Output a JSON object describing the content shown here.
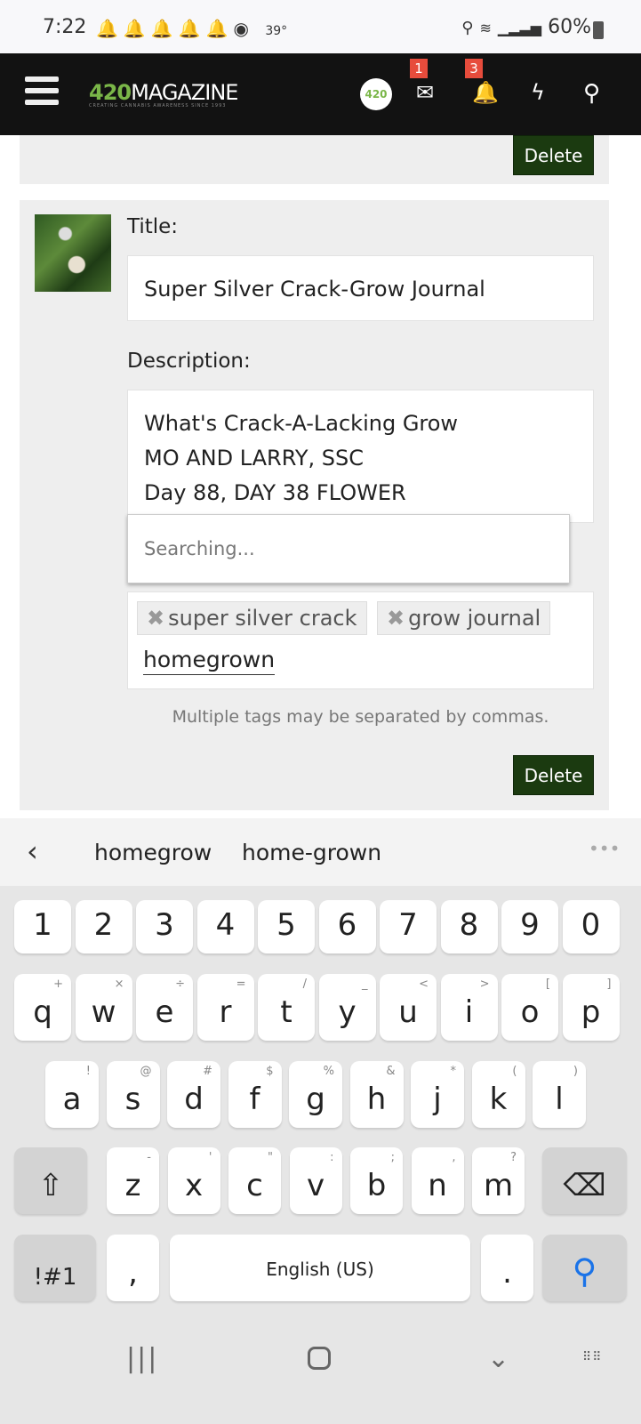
{
  "status": {
    "time": "7:22",
    "temp": "39°",
    "battery": "60%",
    "icons": [
      "bell-icon",
      "bell-icon",
      "bell-icon",
      "bell-icon",
      "bell-icon",
      "chrome-icon",
      "location-icon",
      "wifi-icon",
      "signal-icon",
      "battery-icon"
    ]
  },
  "header": {
    "logo_num": "420",
    "logo_text": "MAGAZINE",
    "logo_tagline": "CREATING CANNABIS AWARENESS SINCE 1993",
    "avatar": "420",
    "messages_count": "1",
    "notifications_count": "3"
  },
  "card1": {
    "delete_label": "Delete"
  },
  "card2": {
    "title_label": "Title:",
    "title_value": "Super Silver Crack-Grow Journal",
    "description_label": "Description:",
    "description_lines": [
      "What's Crack-A-Lacking Grow",
      "MO AND LARRY, SSC",
      "Day 88, DAY 38 FLOWER"
    ],
    "dropdown_text": "Searching...",
    "tags": [
      "super silver crack",
      "grow journal"
    ],
    "tag_input_value": "homegrown",
    "help_text": "Multiple tags may be separated by commas.",
    "delete_label": "Delete"
  },
  "suggestions": [
    "homegrow",
    "home-grown"
  ],
  "keyboard": {
    "numbers": [
      "1",
      "2",
      "3",
      "4",
      "5",
      "6",
      "7",
      "8",
      "9",
      "0"
    ],
    "row1": [
      [
        "q",
        "+"
      ],
      [
        "w",
        "×"
      ],
      [
        "e",
        "÷"
      ],
      [
        "r",
        "="
      ],
      [
        "t",
        "/"
      ],
      [
        "y",
        "_"
      ],
      [
        "u",
        "<"
      ],
      [
        "i",
        ">"
      ],
      [
        "o",
        "["
      ],
      [
        "p",
        "]"
      ]
    ],
    "row2": [
      [
        "a",
        "!"
      ],
      [
        "s",
        "@"
      ],
      [
        "d",
        "#"
      ],
      [
        "f",
        "$"
      ],
      [
        "g",
        "%"
      ],
      [
        "h",
        "&"
      ],
      [
        "j",
        "*"
      ],
      [
        "k",
        "("
      ],
      [
        "l",
        ")"
      ]
    ],
    "row3": [
      [
        "z",
        "-"
      ],
      [
        "x",
        "'"
      ],
      [
        "c",
        "\""
      ],
      [
        "v",
        ":"
      ],
      [
        "b",
        ";"
      ],
      [
        "n",
        ","
      ],
      [
        "m",
        "?"
      ]
    ],
    "symbols_label": "!#1",
    "comma": ",",
    "space_label": "English (US)",
    "period": ".",
    "accent": "#1a73e8"
  },
  "colors": {
    "delete_bg": "#1b3a10",
    "badge": "#e74c3c",
    "logo_green": "#7ab648"
  }
}
